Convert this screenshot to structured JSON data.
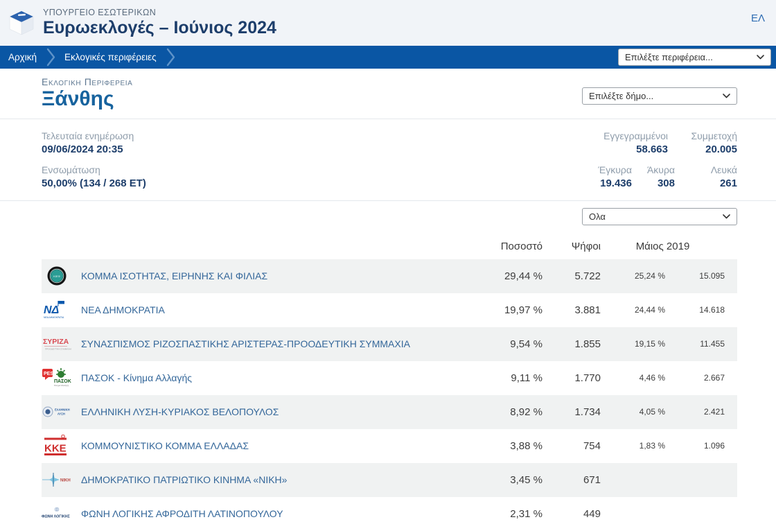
{
  "header": {
    "ministry": "ΥΠΟΥΡΓΕΙΟ ΕΣΩΤΕΡΙΚΩΝ",
    "title": "Ευρωεκλογές – Ιούνιος 2024",
    "language": "ΕΛ"
  },
  "breadcrumb": {
    "items": [
      {
        "label": "Αρχική"
      },
      {
        "label": "Εκλογικές περιφέρειες"
      }
    ],
    "region_select": "Επιλέξτε περιφέρεια..."
  },
  "region": {
    "label": "Εκλογικη Περιφερεια",
    "name": "Ξάνθης",
    "municipality_select": "Επιλέξτε δήμο..."
  },
  "stats": {
    "last_update_label": "Τελευταία ενημέρωση",
    "last_update": "09/06/2024 20:35",
    "integration_label": "Ενσωμάτωση",
    "integration": "50,00% (134 / 268 ΕΤ)",
    "registered_label": "Εγγεγραμμένοι",
    "registered": "58.663",
    "turnout_label": "Συμμετοχή",
    "turnout": "20.005",
    "valid_label": "Έγκυρα",
    "valid": "19.436",
    "invalid_label": "Άκυρα",
    "invalid": "308",
    "blank_label": "Λευκά",
    "blank": "261"
  },
  "filter_select": "Ολα",
  "results_table": {
    "columns": {
      "percent": "Ποσοστό",
      "votes": "Ψήφοι",
      "prev": "Μάιος 2019"
    },
    "rows": [
      {
        "party": "ΚΟΜΜΑ ΙΣΟΤΗΤΑΣ, ΕΙΡΗΝΗΣ ΚΑΙ ΦΙΛΙΑΣ",
        "logo": "kief",
        "percent": "29,44 %",
        "votes": "5.722",
        "prev_percent": "25,24 %",
        "prev_votes": "15.095"
      },
      {
        "party": "ΝΕΑ ΔΗΜΟΚΡΑΤΙΑ",
        "logo": "nd",
        "percent": "19,97 %",
        "votes": "3.881",
        "prev_percent": "24,44 %",
        "prev_votes": "14.618"
      },
      {
        "party": "ΣΥΝΑΣΠΙΣΜΟΣ ΡΙΖΟΣΠΑΣΤΙΚΗΣ ΑΡΙΣΤΕΡΑΣ-ΠΡΟΟΔΕΥΤΙΚΗ ΣΥΜΜΑΧΙΑ",
        "logo": "syriza",
        "percent": "9,54 %",
        "votes": "1.855",
        "prev_percent": "19,15 %",
        "prev_votes": "11.455"
      },
      {
        "party": "ΠΑΣΟΚ - Κίνημα Αλλαγής",
        "logo": "pasok",
        "percent": "9,11 %",
        "votes": "1.770",
        "prev_percent": "4,46 %",
        "prev_votes": "2.667"
      },
      {
        "party": "ΕΛΛΗΝΙΚΗ ΛΥΣΗ-ΚΥΡΙΑΚΟΣ ΒΕΛΟΠΟΥΛΟΣ",
        "logo": "elliniki-lysi",
        "percent": "8,92 %",
        "votes": "1.734",
        "prev_percent": "4,05 %",
        "prev_votes": "2.421"
      },
      {
        "party": "ΚΟΜΜΟΥΝΙΣΤΙΚΟ ΚΟΜΜΑ ΕΛΛΑΔΑΣ",
        "logo": "kke",
        "percent": "3,88 %",
        "votes": "754",
        "prev_percent": "1,83 %",
        "prev_votes": "1.096"
      },
      {
        "party": "ΔΗΜΟΚΡΑΤΙΚΟ ΠΑΤΡΙΩΤΙΚΟ ΚΙΝΗΜΑ «ΝΙΚΗ»",
        "logo": "niki",
        "percent": "3,45 %",
        "votes": "671",
        "prev_percent": "",
        "prev_votes": ""
      },
      {
        "party": "ΦΩΝΗ ΛΟΓΙΚΗΣ ΑΦΡΟΔΙΤΗ ΛΑΤΙΝΟΠΟΥΛΟΥ",
        "logo": "foni-logikis",
        "percent": "2,31 %",
        "votes": "449",
        "prev_percent": "",
        "prev_votes": ""
      }
    ]
  },
  "colors": {
    "breadcrumb_bar": "#0a56a4",
    "navy_text": "#1d3e6b",
    "region_blue": "#17639e",
    "party_link_blue": "#34679a",
    "stripe_gray": "#f0f2f2",
    "band_gray": "#f1f4f8"
  }
}
